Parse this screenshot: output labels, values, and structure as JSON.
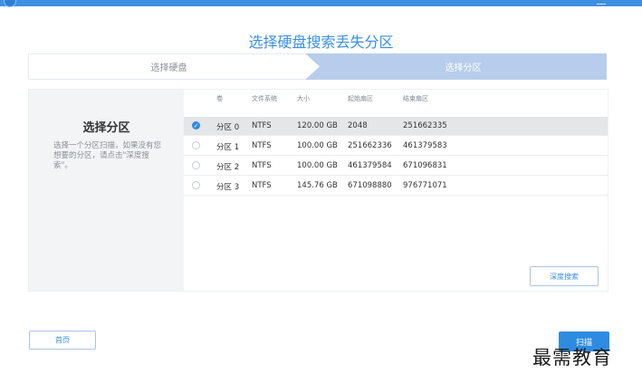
{
  "page": {
    "title": "选择硬盘搜索丢失分区"
  },
  "steps": [
    {
      "label": "选择硬盘",
      "active": false
    },
    {
      "label": "选择分区",
      "active": true
    }
  ],
  "left_panel": {
    "title": "选择分区",
    "description": "选择一个分区扫描，如果没有您想要的分区，请点击\"深度搜索\"。"
  },
  "table": {
    "headers": [
      "卷",
      "文件系统",
      "大小",
      "起始扇区",
      "结束扇区"
    ],
    "rows": [
      {
        "volume": "分区 0",
        "fs": "NTFS",
        "size": "120.00 GB",
        "start": "2048",
        "end": "251662335",
        "selected": true
      },
      {
        "volume": "分区 1",
        "fs": "NTFS",
        "size": "100.00 GB",
        "start": "251662336",
        "end": "461379583",
        "selected": false
      },
      {
        "volume": "分区 2",
        "fs": "NTFS",
        "size": "100.00 GB",
        "start": "461379584",
        "end": "671096831",
        "selected": false
      },
      {
        "volume": "分区 3",
        "fs": "NTFS",
        "size": "145.76 GB",
        "start": "671098880",
        "end": "976771071",
        "selected": false
      }
    ]
  },
  "buttons": {
    "deep_search": "深度搜索",
    "home": "首页",
    "scan": "扫描"
  },
  "watermark": "最需教育",
  "colors": {
    "accent": "#2f8be0",
    "title_blue": "#3a8ee6",
    "step_active": "#b7cdeb"
  }
}
